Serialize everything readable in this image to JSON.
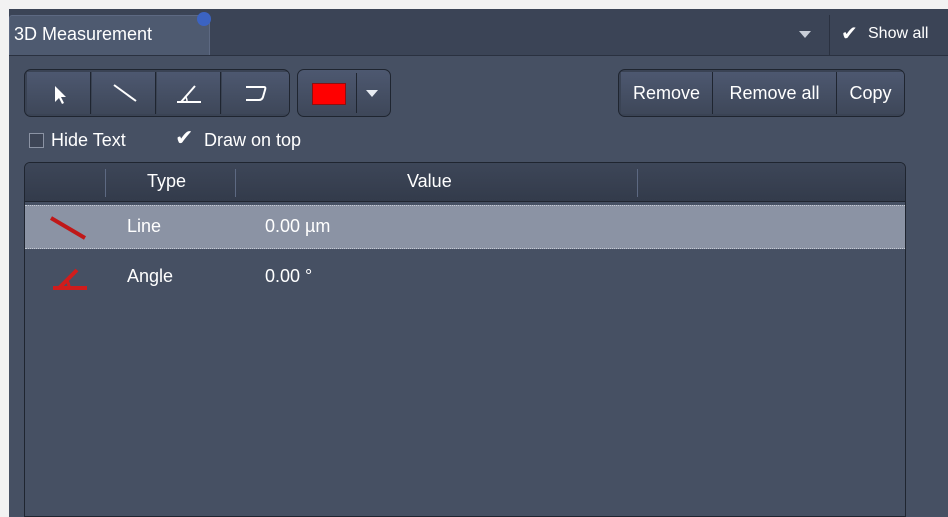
{
  "panel": {
    "tab_title": "3D Measurement",
    "show_all_label": "Show all"
  },
  "toolbar": {
    "tools": [
      {
        "icon": "pointer-arrow-icon"
      },
      {
        "icon": "line-tool-icon"
      },
      {
        "icon": "angle-tool-icon"
      },
      {
        "icon": "curve-tool-icon"
      }
    ],
    "color": "#ff0000",
    "remove_label": "Remove",
    "remove_all_label": "Remove all",
    "copy_label": "Copy"
  },
  "options": {
    "hide_text_label": "Hide Text",
    "hide_text_checked": false,
    "draw_on_top_label": "Draw on top",
    "draw_on_top_checked": true
  },
  "table": {
    "columns": [
      "",
      "Type",
      "Value",
      ""
    ],
    "rows": [
      {
        "icon": "line-measure-icon",
        "type": "Line",
        "value": "0.00 µm",
        "selected": true
      },
      {
        "icon": "angle-measure-icon",
        "type": "Angle",
        "value": "0.00 °",
        "selected": false
      }
    ]
  },
  "colors": {
    "panel_bg": "#465063",
    "selected_row": "#8b93a4",
    "accent_red": "#ff0000"
  }
}
